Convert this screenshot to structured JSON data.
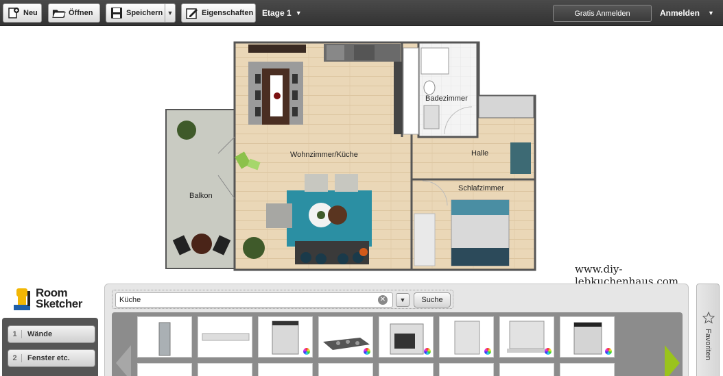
{
  "toolbar": {
    "new_label": "Neu",
    "open_label": "Öffnen",
    "save_label": "Speichern",
    "properties_label": "Eigenschaften",
    "floor_label": "Etage 1",
    "signup_label": "Gratis Anmelden",
    "login_label": "Anmelden"
  },
  "floorplan": {
    "rooms": {
      "living": "Wohnzimmer/Küche",
      "bath": "Badezimmer",
      "hall": "Halle",
      "bedroom": "Schlafzimmer",
      "balcony": "Balkon"
    }
  },
  "watermark": "www.diy-lebkuchenhaus.com",
  "logo": {
    "line1": "Room",
    "line2": "Sketcher"
  },
  "steps": [
    {
      "num": "1",
      "label": "Wände"
    },
    {
      "num": "2",
      "label": "Fenster etc."
    }
  ],
  "catalog": {
    "search_value": "Küche",
    "search_button": "Suche"
  },
  "favorites_label": "Favoriten",
  "colors": {
    "toolbar_bg": "#3d3d3d",
    "accent_green": "#9ac31c",
    "floor_wood": "#e8d4b4",
    "rug_teal": "#2b8fa3"
  }
}
